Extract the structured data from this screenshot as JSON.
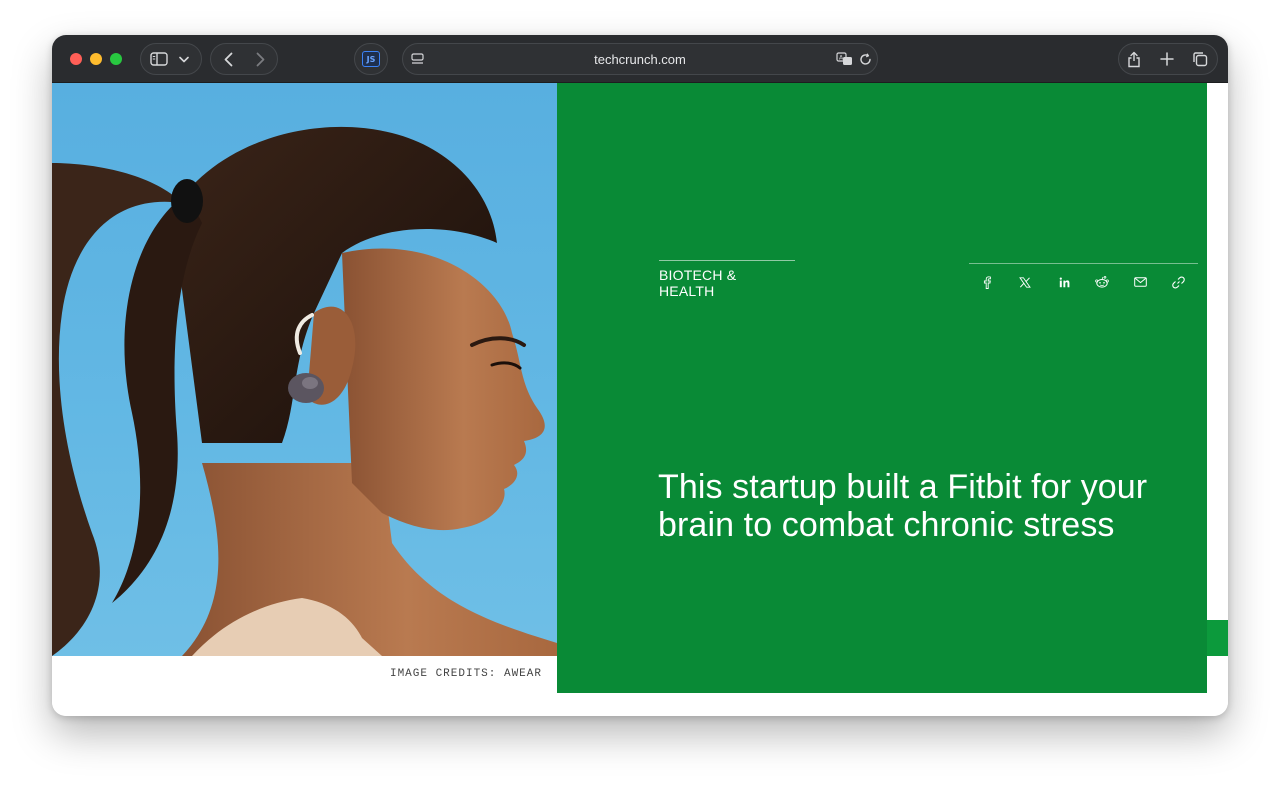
{
  "browser": {
    "url": "techcrunch.com",
    "extension_badge": "JS"
  },
  "article": {
    "category": "BIOTECH & HEALTH",
    "headline": "This startup built a Fitbit for your brain to combat chronic stress",
    "image_credit": "IMAGE CREDITS: AWEAR"
  },
  "share_icons": [
    "facebook-icon",
    "x-icon",
    "linkedin-icon",
    "reddit-icon",
    "email-icon",
    "link-icon"
  ],
  "colors": {
    "panel_green": "#098a36",
    "sky_blue": "#5db3e2",
    "toolbar": "#2a2c2f"
  }
}
